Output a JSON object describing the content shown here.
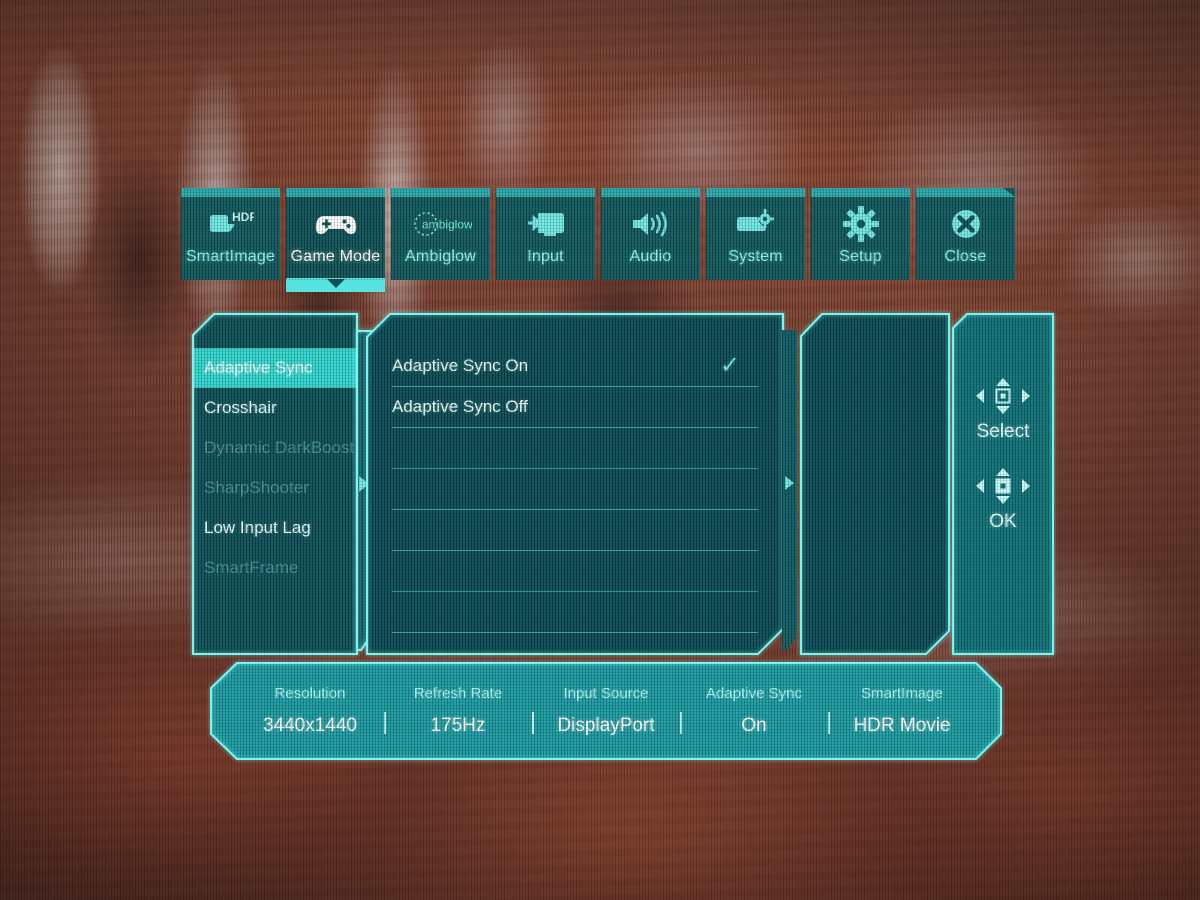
{
  "osd": {
    "device": "Philips Monitor OSD",
    "accent_bright": "#57e4e0",
    "accent_panel": "#0a4a52",
    "accent_tab": "#11585c",
    "accent_status": "#1a9aa0",
    "highlight": "#2fd5cd"
  },
  "tabs": [
    {
      "label": "SmartImage",
      "icon": "smartimage-hdr-icon",
      "active": false
    },
    {
      "label": "Game Mode",
      "icon": "gamepad-icon",
      "active": true
    },
    {
      "label": "Ambiglow",
      "icon": "ambiglow-icon",
      "active": false
    },
    {
      "label": "Input",
      "icon": "input-monitor-icon",
      "active": false
    },
    {
      "label": "Audio",
      "icon": "speaker-icon",
      "active": false
    },
    {
      "label": "System",
      "icon": "system-gear-icon",
      "active": false
    },
    {
      "label": "Setup",
      "icon": "gear-icon",
      "active": false
    },
    {
      "label": "Close",
      "icon": "close-circle-icon",
      "active": false
    }
  ],
  "sidebar": {
    "items": [
      {
        "label": "Adaptive Sync",
        "state": "selected"
      },
      {
        "label": "Crosshair",
        "state": "normal"
      },
      {
        "label": "Dynamic DarkBoost",
        "state": "disabled"
      },
      {
        "label": "SharpShooter",
        "state": "disabled"
      },
      {
        "label": "Low Input Lag",
        "state": "normal"
      },
      {
        "label": "SmartFrame",
        "state": "disabled"
      }
    ]
  },
  "options": {
    "items": [
      {
        "label": "Adaptive Sync On",
        "checked": true
      },
      {
        "label": "Adaptive Sync Off",
        "checked": false
      },
      {
        "label": "",
        "checked": false
      },
      {
        "label": "",
        "checked": false
      },
      {
        "label": "",
        "checked": false
      },
      {
        "label": "",
        "checked": false
      },
      {
        "label": "",
        "checked": false
      }
    ],
    "checkmark": "✓"
  },
  "nav_help": {
    "select_label": "Select",
    "ok_label": "OK"
  },
  "status": {
    "cells": [
      {
        "label": "Resolution",
        "value": "3440x1440"
      },
      {
        "label": "Refresh Rate",
        "value": "175Hz"
      },
      {
        "label": "Input Source",
        "value": "DisplayPort"
      },
      {
        "label": "Adaptive Sync",
        "value": "On"
      },
      {
        "label": "SmartImage",
        "value": "HDR Movie"
      }
    ]
  }
}
